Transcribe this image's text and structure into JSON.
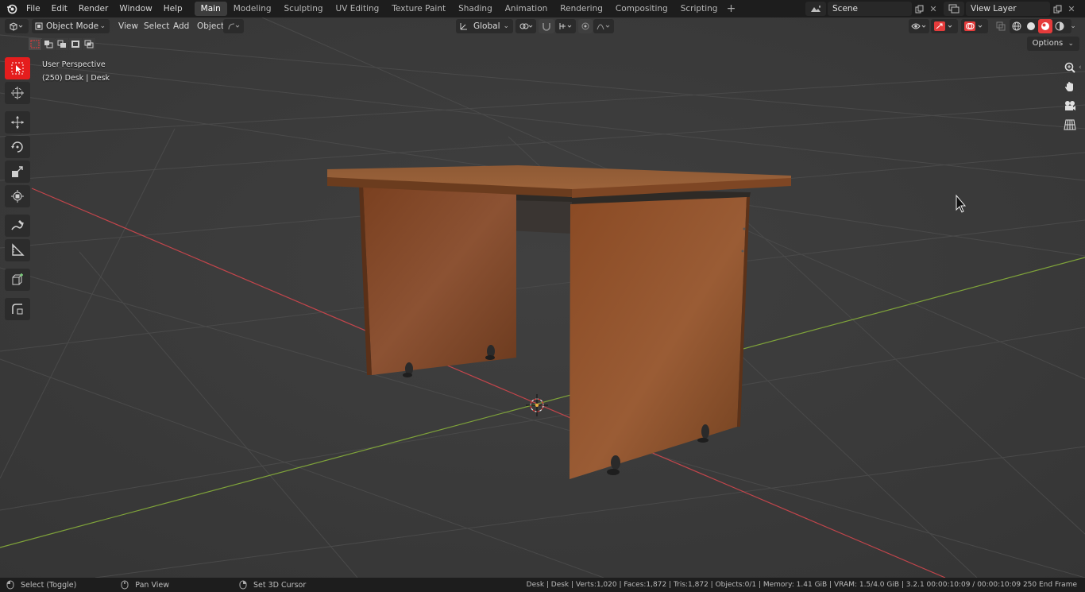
{
  "menus": [
    "File",
    "Edit",
    "Render",
    "Window",
    "Help"
  ],
  "workspaces": [
    "Main",
    "Modeling",
    "Sculpting",
    "UV Editing",
    "Texture Paint",
    "Shading",
    "Animation",
    "Rendering",
    "Compositing",
    "Scripting"
  ],
  "workspace_add": "+",
  "scene": {
    "name": "Scene"
  },
  "view_layer": {
    "name": "View Layer"
  },
  "viewport": {
    "mode": "Object Mode",
    "menu": {
      "view": "View",
      "select": "Select",
      "add": "Add",
      "object": "Object"
    },
    "transform_orientation": "Global",
    "options_label": "Options",
    "perspective_label": "User Perspective",
    "object_label": "(250) Desk | Desk"
  },
  "status": {
    "hint_select": "Select (Toggle)",
    "hint_pan": "Pan View",
    "hint_cursor": "Set 3D Cursor",
    "info": "Desk | Desk | Verts:1,020 | Faces:1,872 | Tris:1,872 | Objects:0/1 | Memory: 1.41 GiB | VRAM: 1.5/4.0 GiB | 3.2.1   00:00:10:09 / 00:00:10:09   250 End Frame"
  },
  "colors": {
    "accent": "#e51d1d",
    "x_axis": "#c2454b",
    "y_axis": "#7fa33a",
    "wood": "#8a4d28"
  }
}
